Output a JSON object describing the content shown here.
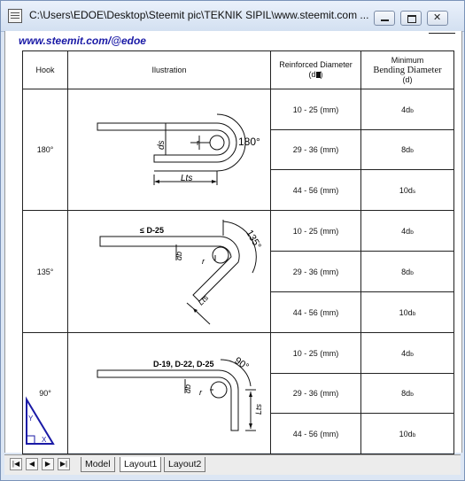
{
  "window": {
    "title": "C:\\Users\\EDOE\\Desktop\\Steemit pic\\TEKNIK SIPIL\\www.steemit.com ...",
    "minimize_glyph": "",
    "maximize_glyph": "",
    "close_glyph": ""
  },
  "drawing": {
    "site_url": "www.steemit.com/@edoe",
    "table": {
      "headers": {
        "hook": "Hook",
        "illustration": "Ilustration",
        "diameter_line1": "Reinforced Diameter",
        "diameter_line2_prefix": "(d",
        "diameter_line2_suffix": ")",
        "min_line1": "Minimum",
        "min_line2": "Bending Diameter",
        "min_line3": "(d)"
      },
      "groups": [
        {
          "hook": "180°",
          "labels": {
            "db": "ds",
            "r": "r",
            "angle": "180°",
            "lts": "Lts"
          },
          "rows": [
            {
              "diameter": "10 - 25 (mm)",
              "bend": "4d",
              "sub": "b"
            },
            {
              "diameter": "29 - 36 (mm)",
              "bend": "8d",
              "sub": "b"
            },
            {
              "diameter": "44 - 56 (mm)",
              "bend": "10d",
              "sub": "s"
            }
          ]
        },
        {
          "hook": "135°",
          "labels": {
            "bar": "≤ D-25",
            "db": "db",
            "r": "r",
            "angle": "135°",
            "lts": "Lts"
          },
          "rows": [
            {
              "diameter": "10 - 25 (mm)",
              "bend": "4d",
              "sub": "b"
            },
            {
              "diameter": "29 - 36 (mm)",
              "bend": "8d",
              "sub": "b"
            },
            {
              "diameter": "44 - 56 (mm)",
              "bend": "10d",
              "sub": "b"
            }
          ]
        },
        {
          "hook": "90°",
          "labels": {
            "bar": "D-19, D-22, D-25",
            "db": "db",
            "r": "r",
            "angle": "90°",
            "lts": "Lts"
          },
          "rows": [
            {
              "diameter": "10 - 25 (mm)",
              "bend": "4d",
              "sub": "b"
            },
            {
              "diameter": "29 - 36 (mm)",
              "bend": "8d",
              "sub": "b"
            },
            {
              "diameter": "44 - 56 (mm)",
              "bend": "10d",
              "sub": "b"
            }
          ]
        }
      ]
    },
    "ucs_labels": {
      "y": "Y",
      "x": "X"
    }
  },
  "tabs": [
    "Model",
    "Layout1",
    "Layout2"
  ],
  "active_tab": "Layout1",
  "nav_buttons": [
    "|◀",
    "◀",
    "▶",
    "▶|"
  ]
}
